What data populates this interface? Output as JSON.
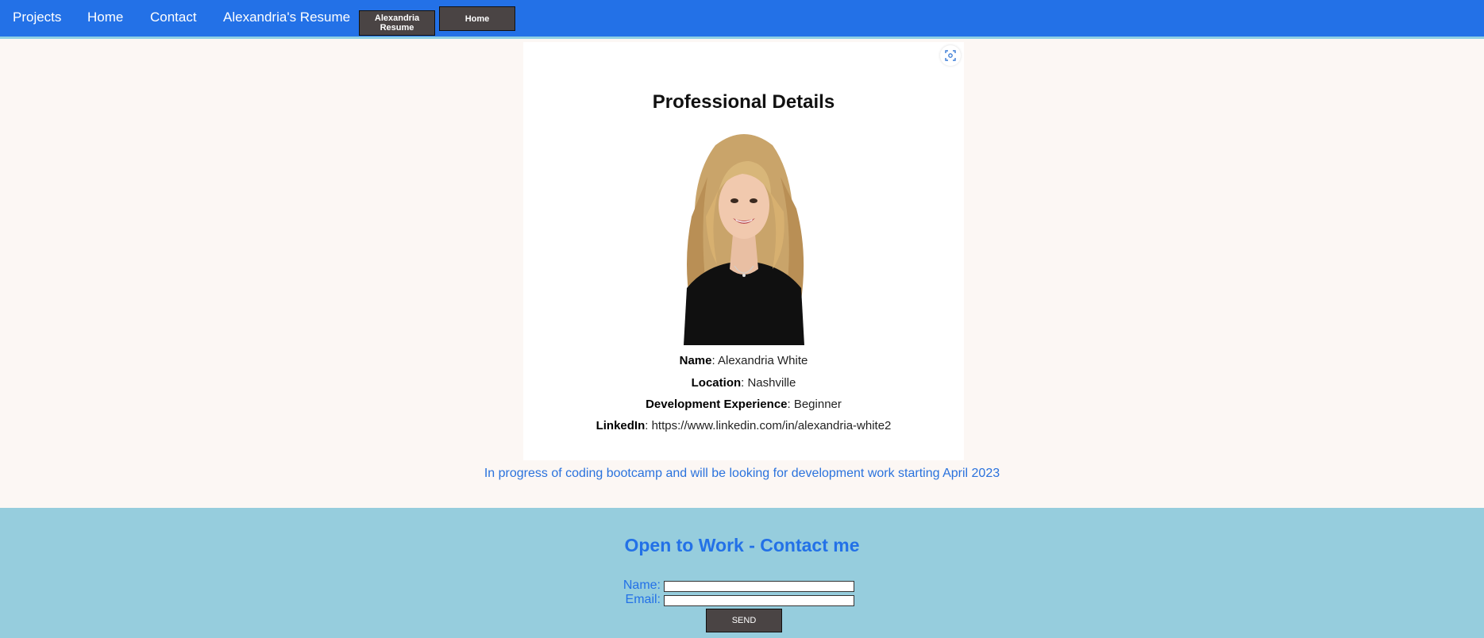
{
  "nav": {
    "links": [
      "Projects",
      "Home",
      "Contact",
      "Alexandria's Resume"
    ],
    "buttons": [
      "Alexandria Resume",
      "Home"
    ]
  },
  "card": {
    "title": "Professional Details",
    "photo_alt": "Portrait of Alexandria White",
    "details": [
      {
        "label": "Name",
        "value": ": Alexandria White"
      },
      {
        "label": "Location",
        "value": ": Nashville"
      },
      {
        "label": "Development Experience",
        "value": ": Beginner"
      },
      {
        "label": "LinkedIn",
        "value": ": https://www.linkedin.com/in/alexandria-white2"
      }
    ]
  },
  "status": "In progress of coding bootcamp and will be looking for development work starting April 2023",
  "contact": {
    "title": "Open to Work - Contact me",
    "name_label": "Name:",
    "email_label": "Email:",
    "name_value": "",
    "email_value": "",
    "send_label": "SEND"
  },
  "colors": {
    "nav": "#2371e7",
    "accent": "#2371e7",
    "contact_bg": "#96cddd",
    "page_bg": "#fcf7f4",
    "button": "#4a4444"
  }
}
